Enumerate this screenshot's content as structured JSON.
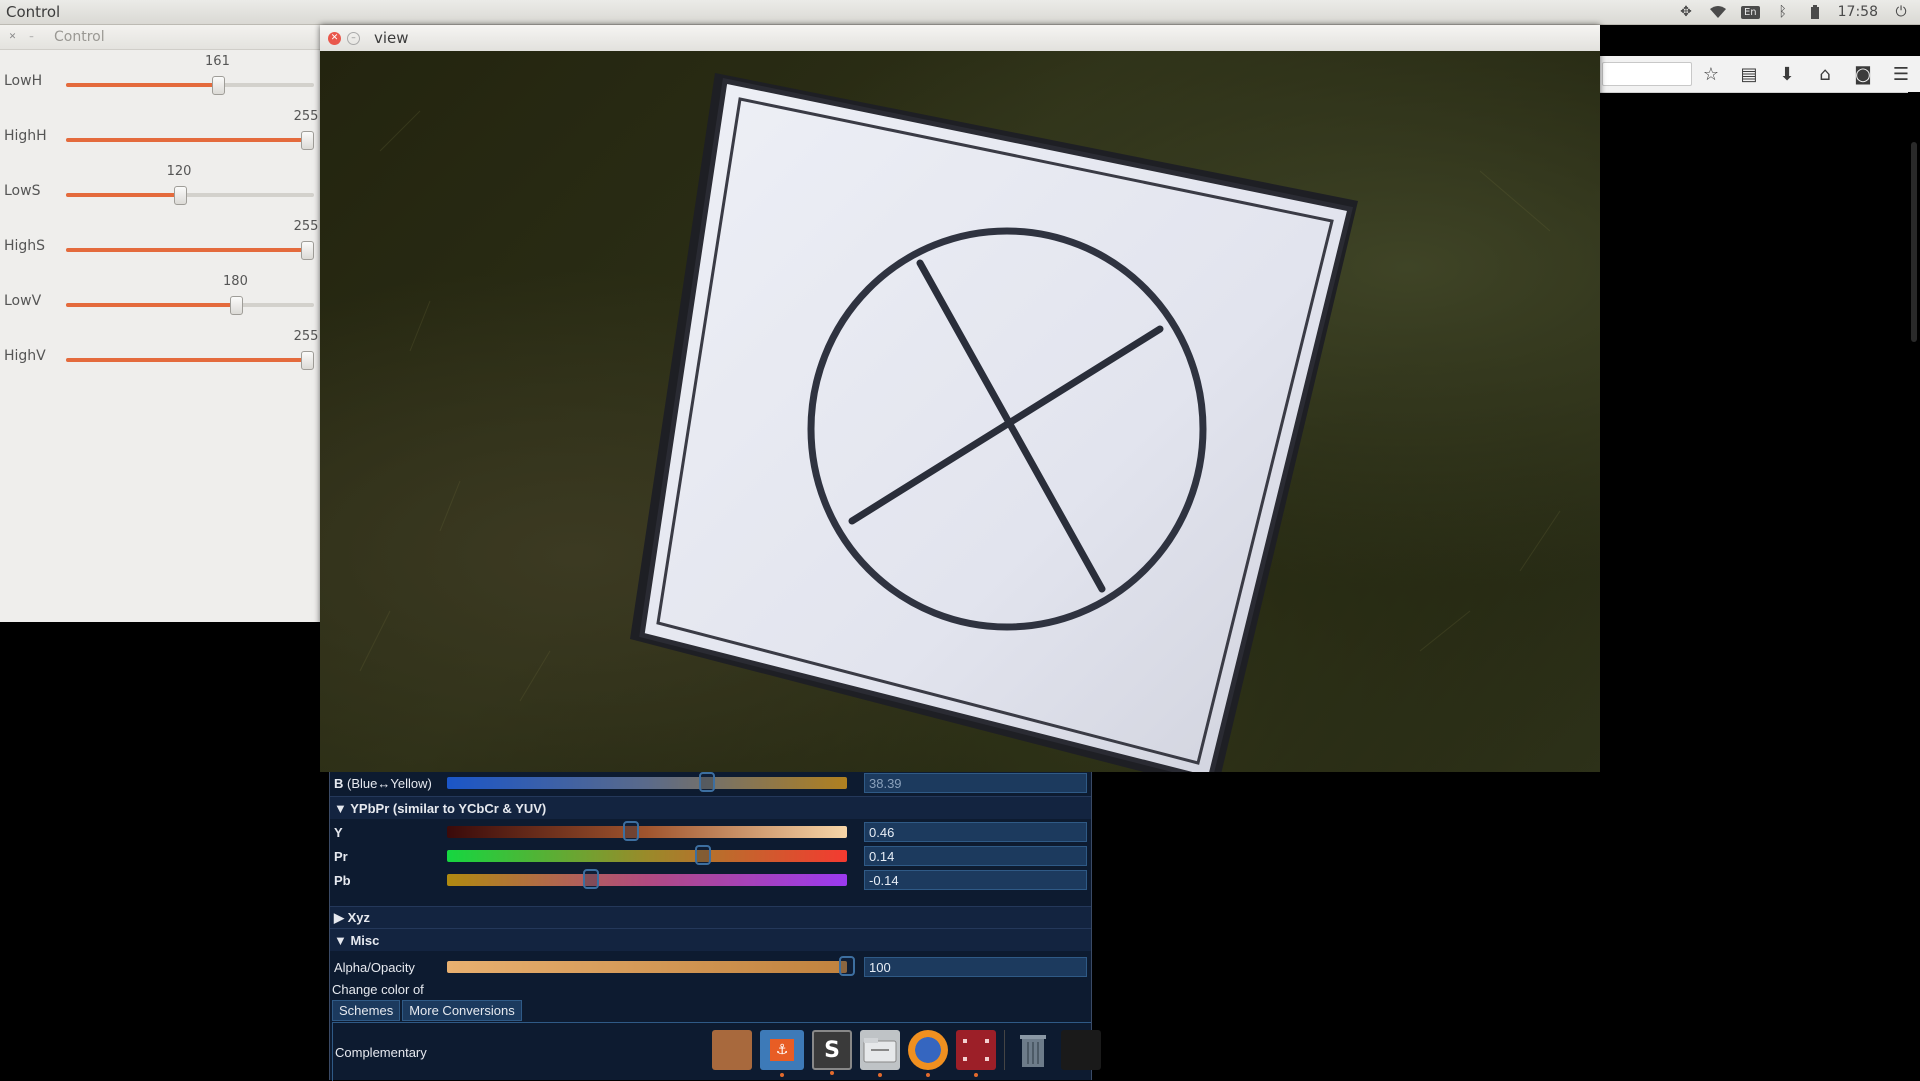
{
  "topbar": {
    "app_title": "Control",
    "lang": "En",
    "time": "17:58"
  },
  "control_window": {
    "title": "Control",
    "sliders": [
      {
        "label": "LowH",
        "value": "161",
        "fraction": 0.631
      },
      {
        "label": "HighH",
        "value": "255",
        "fraction": 1.0
      },
      {
        "label": "LowS",
        "value": "120",
        "fraction": 0.471
      },
      {
        "label": "HighS",
        "value": "255",
        "fraction": 1.0
      },
      {
        "label": "LowV",
        "value": "180",
        "fraction": 0.706
      },
      {
        "label": "HighV",
        "value": "255",
        "fraction": 1.0
      }
    ]
  },
  "view_window": {
    "title": "view"
  },
  "color_panel": {
    "b_row": {
      "label": "B",
      "sub": "(Blue↔Yellow)",
      "value": "38.39",
      "fraction": 0.65
    },
    "ypbpr_header": "▼ YPbPr (similar to YCbCr & YUV)",
    "ypbpr": [
      {
        "label": "Y",
        "value": "0.46",
        "fraction": 0.46
      },
      {
        "label": "Pr",
        "value": "0.14",
        "fraction": 0.64
      },
      {
        "label": "Pb",
        "value": "-0.14",
        "fraction": 0.36
      }
    ],
    "xyz_header": "▶ Xyz",
    "misc_header": "▼ Misc",
    "alpha": {
      "label": "Alpha/Opacity",
      "value": "100",
      "fraction": 1.0
    },
    "change_color_label": "Change color of",
    "tabs": [
      "Schemes",
      "More Conversions"
    ],
    "scheme_label": "Complementary"
  },
  "colors": {
    "accent": "#e46a3c",
    "panel_bg": "#0d1b30",
    "swatch": "#a8693d"
  }
}
